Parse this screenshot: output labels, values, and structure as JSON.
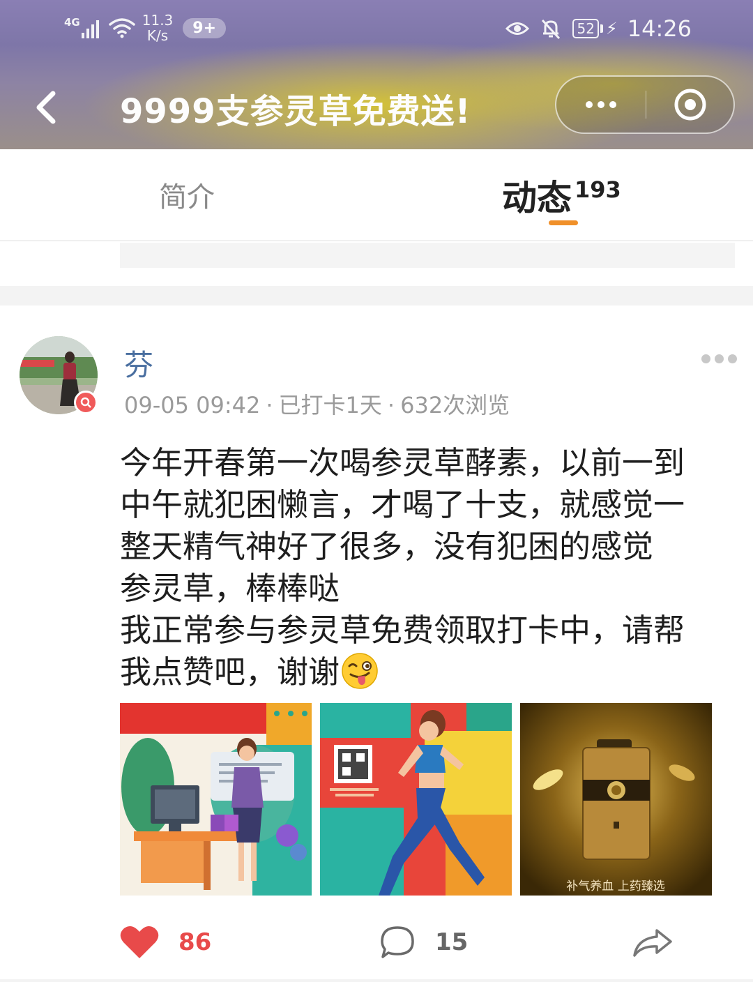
{
  "status_bar": {
    "network": "4G",
    "speed_value": "11.3",
    "speed_unit": "K/s",
    "notification_badge": "9+",
    "battery": "52",
    "time": "14:26",
    "icons": [
      "signal-icon",
      "wifi-icon",
      "eye-icon",
      "bell-muted-icon",
      "battery-icon",
      "charging-icon"
    ]
  },
  "header": {
    "title": "9999支参灵草免费送!",
    "back_icon": "back-chevron-icon",
    "capsule_icons": [
      "more-dots-icon",
      "close-target-icon"
    ]
  },
  "tabs": [
    {
      "label": "简介",
      "active": false
    },
    {
      "label": "动态",
      "count": "193",
      "active": true
    }
  ],
  "colors": {
    "accent": "#f0902a",
    "author": "#4a6fa0",
    "like": "#e84a4a",
    "meta": "#9a9a9a"
  },
  "post": {
    "author": "芬",
    "date": "09-05 09:42",
    "checkin": "已打卡1天",
    "views": "632次浏览",
    "separator": "·",
    "lines": [
      "今年开春第一次喝参灵草酵素，以前一到",
      "中午就犯困懒言，才喝了十支，就感觉一",
      "整天精气神好了很多，没有犯困的感觉",
      "参灵草，棒棒哒",
      "我正常参与参灵草免费领取打卡中，请帮",
      "我点赞吧，谢谢"
    ],
    "emoji": "winking-face-with-tongue",
    "photos": [
      {
        "name": "office-woman-illustration"
      },
      {
        "name": "running-woman-illustration"
      },
      {
        "name": "gold-gift-box",
        "caption": "补气养血 上药臻选"
      }
    ]
  },
  "actions": {
    "likes": "86",
    "comments": "15",
    "icons": [
      "heart-icon",
      "comment-icon",
      "share-icon"
    ]
  }
}
